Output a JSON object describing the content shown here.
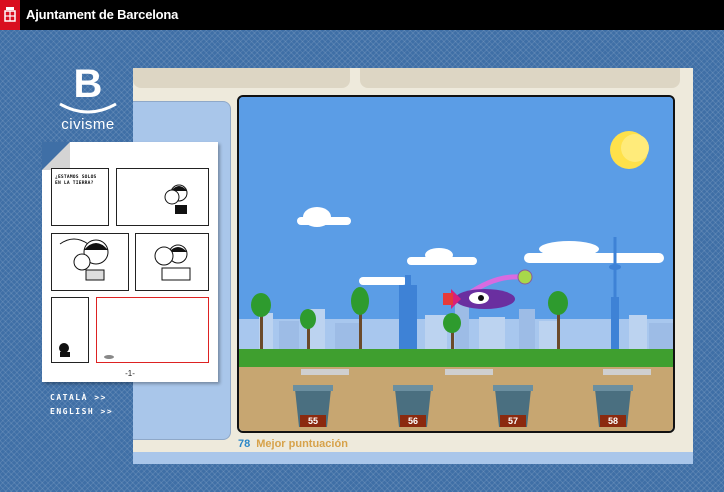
{
  "header": {
    "organization": "Ajuntament de Barcelona",
    "logo_icon": "barcelona-crest-icon"
  },
  "brand": {
    "letter": "B",
    "name": "civisme"
  },
  "languages": [
    {
      "label": "CATALÀ >>"
    },
    {
      "label": "ENGLISH >>"
    }
  ],
  "comic": {
    "title_line1": "¿ESTAMOS SOLOS",
    "title_line2": "EN LA TIERRA?",
    "page": "-1-"
  },
  "game": {
    "can_numbers": [
      "55",
      "56",
      "57",
      "58"
    ],
    "score": "78",
    "best_score_label": "Mejor puntuación"
  },
  "colors": {
    "sky": "#5b9de6",
    "accent_red": "#d90f1f",
    "score_num": "#2a87c8",
    "score_label": "#d7a24a"
  }
}
